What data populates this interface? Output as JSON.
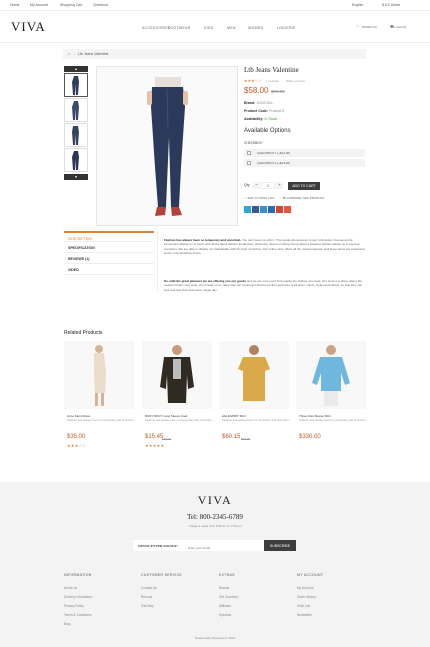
{
  "topbar": {
    "home": "Home",
    "my_account": "My Account",
    "shopping_cart": "Shopping Cart",
    "checkout": "Checkout",
    "language": "English",
    "currency": "$ US Dollar"
  },
  "header": {
    "logo": "VIVA",
    "nav": [
      "ACCESSORIES",
      "FOOTWEAR",
      "KIDS",
      "MEN",
      "WOMEN",
      "LINGERIE"
    ],
    "wishlist": "Wishlist (0)",
    "cart": "Cart (0)"
  },
  "breadcrumb": {
    "current": "Ltb Jeans Valentine"
  },
  "product": {
    "title": "Ltb Jeans Valentine",
    "reviews": "1 reviews",
    "write_review": "Write a review",
    "rating": 3,
    "price": "$58.00",
    "old_price": "$75.00",
    "brand_label": "Brand:",
    "brand_value": "JUDICOLL",
    "code_label": "Product Code:",
    "code_value": "Product 5",
    "avail_label": "Availability:",
    "avail_value": "In Stock",
    "options_title": "Available Options",
    "checkbox_title": "CHECKBOX",
    "checkbox_options": [
      "CHECKBOX 1 (+$12.00)",
      "CHECKBOX 2 (+$13.00)"
    ],
    "qty_label": "Qty",
    "qty_value": "1",
    "add_to_cart": "ADD TO CART",
    "wishlist": "ADD TO WISH LIST",
    "compare": "COMPARE THIS PRODUCT"
  },
  "tabs": [
    "DESCRIPTION",
    "SPECIFICATION",
    "REVIEWS (1)",
    "VIDEO"
  ],
  "description": {
    "p1_bold": "Fashion has always been so temporary and uncertain.",
    "p1": "You can't keep up with it. This social phenomenon is very whimsical, thus we as the consumers always try to touch with all the latest fashion tendencies. Obviously there is nothing wrong about it because fashion allows us to express ourselves. We are able to display our individuality with the help of clothes. Our online store offers all the newest apparel, and these items are presented at the most attractive prices.",
    "p2_bold": "So, with the great pleasure we are offering you our goods",
    "p2": "and we are sure you'll find exactly the clothes you need. Our store is a place where the newest trends meet style. Our mission is to make sure our customers find the perfect garments of all sizes, colors, styles and fabrics, so that they can look and feel their best every single day."
  },
  "related": {
    "title": "Related Products",
    "items": [
      {
        "name": "Anne Klein Dress",
        "desc": "Fashion has always been so temporary and uncertain...",
        "price": "$35.00",
        "old": "",
        "stars": "★★★☆☆"
      },
      {
        "name": "DKNY DKNY Long Sleeve Coat",
        "desc": "Fashion has always been so temporary and uncertain...",
        "price": "$15.45",
        "old": "$30.00",
        "stars": "★★★★★"
      },
      {
        "name": "ellis ESPRIT Shirt",
        "desc": "Fashion has always been so temporary and uncertain...",
        "price": "$60.15",
        "old": "$86.00",
        "stars": ""
      },
      {
        "name": "Three Dots Sleeve Shirt",
        "desc": "Fashion has always been so temporary and uncertain...",
        "price": "$330.00",
        "old": "",
        "stars": ""
      }
    ]
  },
  "footer": {
    "logo": "VIVA",
    "phone": "Tel: 800-2345-6789",
    "hours": "7 Days a week from 9:00 am to 7:00 pm",
    "newsletter_label": "NEWSLETTER SIGNUP :",
    "newsletter_placeholder": "Enter your email",
    "subscribe": "SUBSCRIBE",
    "columns": [
      {
        "title": "INFORMATION",
        "links": [
          "About Us",
          "Delivery Information",
          "Privacy Policy",
          "Terms & Conditions",
          "Blog"
        ]
      },
      {
        "title": "CUSTOMER SERVICE",
        "links": [
          "Contact Us",
          "Returns",
          "Site Map"
        ]
      },
      {
        "title": "EXTRAS",
        "links": [
          "Brands",
          "Gift Vouchers",
          "Affiliates",
          "Specials"
        ]
      },
      {
        "title": "MY ACCOUNT",
        "links": [
          "My Account",
          "Order History",
          "Wish List",
          "Newsletter"
        ]
      }
    ],
    "copyright": "Powered By OpenCart © 2016"
  },
  "colors": {
    "accent": "#d9833e",
    "price": "#c35a24",
    "dark_button": "#3d3d3d",
    "footer_bg": "#f3f3f3"
  },
  "icons": [
    "home-icon",
    "heart-icon",
    "cart-icon",
    "chevron-up-icon",
    "chevron-down-icon"
  ]
}
